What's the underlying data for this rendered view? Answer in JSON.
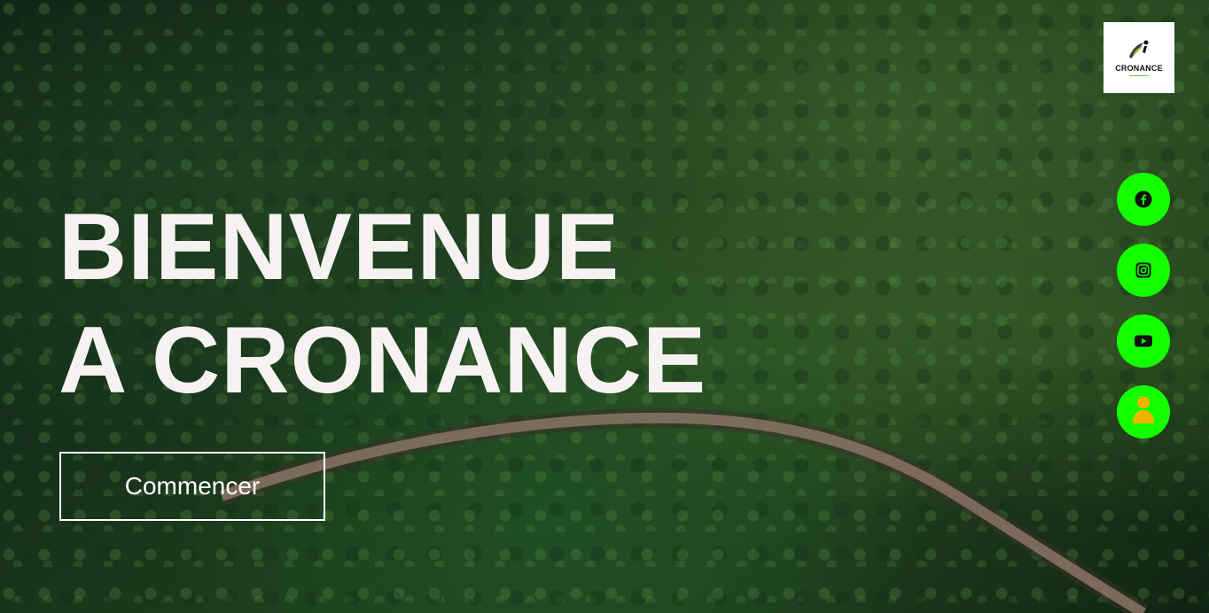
{
  "brand": {
    "logo_text": "CRONANCE",
    "logo_icon": "runner-leaf-icon"
  },
  "hero": {
    "headline_line1": "BIENVENUE",
    "headline_line2": "A CRONANCE",
    "cta_label": "Commencer"
  },
  "social": [
    {
      "icon": "facebook-icon"
    },
    {
      "icon": "instagram-icon"
    },
    {
      "icon": "youtube-icon"
    },
    {
      "icon": "user-icon"
    }
  ],
  "colors": {
    "accent": "#14ff00",
    "headline": "#f6f2f1",
    "user_icon": "#f2b400"
  }
}
